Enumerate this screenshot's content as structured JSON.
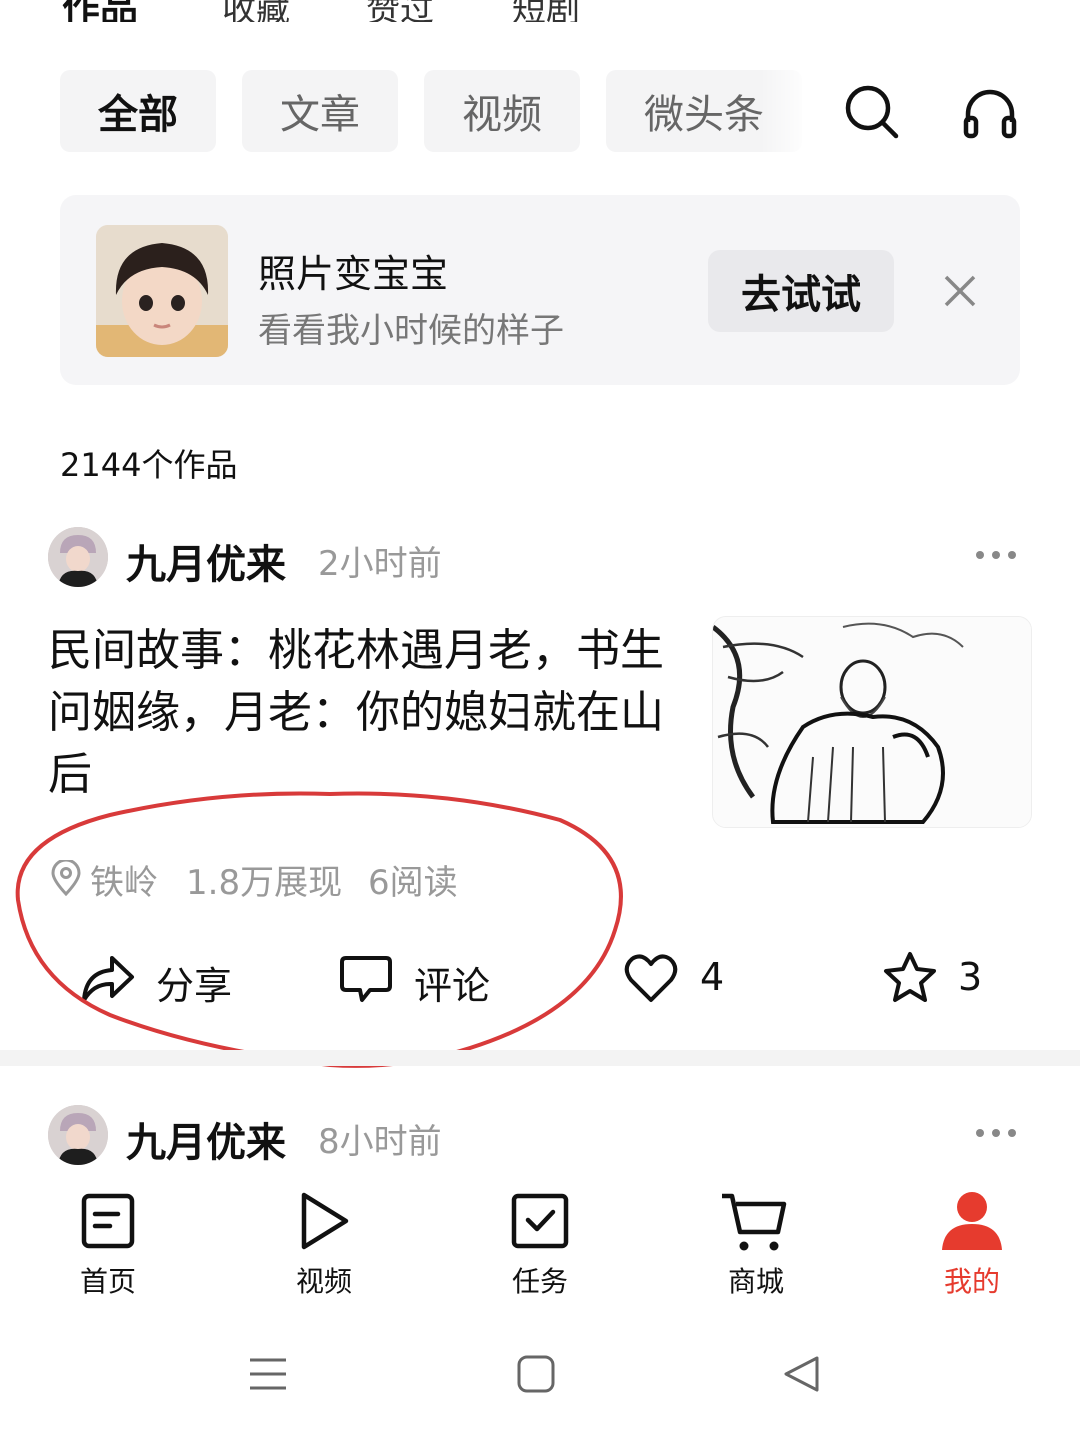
{
  "top_tabs": [
    "作品",
    "收藏",
    "赞过",
    "短剧"
  ],
  "filter_chips": [
    "全部",
    "文章",
    "视频",
    "微头条"
  ],
  "banner": {
    "title": "照片变宝宝",
    "subtitle": "看看我小时候的样子",
    "button": "去试试"
  },
  "works_count": "2144个作品",
  "posts": [
    {
      "author": "九月优来",
      "time": "2小时前",
      "title": "民间故事：桃花林遇月老，书生问姻缘，月老：你的媳妇就在山后",
      "location": "铁岭",
      "impressions": "1.8万展现",
      "reads": "6阅读",
      "actions": {
        "share": "分享",
        "comment": "评论",
        "likes": "4",
        "favorites": "3"
      }
    },
    {
      "author": "九月优来",
      "time": "8小时前"
    }
  ],
  "bottom_nav": [
    {
      "label": "首页",
      "icon": "home-doc-icon"
    },
    {
      "label": "视频",
      "icon": "play-icon"
    },
    {
      "label": "任务",
      "icon": "task-check-icon"
    },
    {
      "label": "商城",
      "icon": "cart-icon"
    },
    {
      "label": "我的",
      "icon": "person-icon",
      "active": true
    }
  ],
  "colors": {
    "accent": "#e63b2e",
    "annotation": "#d83a3a"
  }
}
